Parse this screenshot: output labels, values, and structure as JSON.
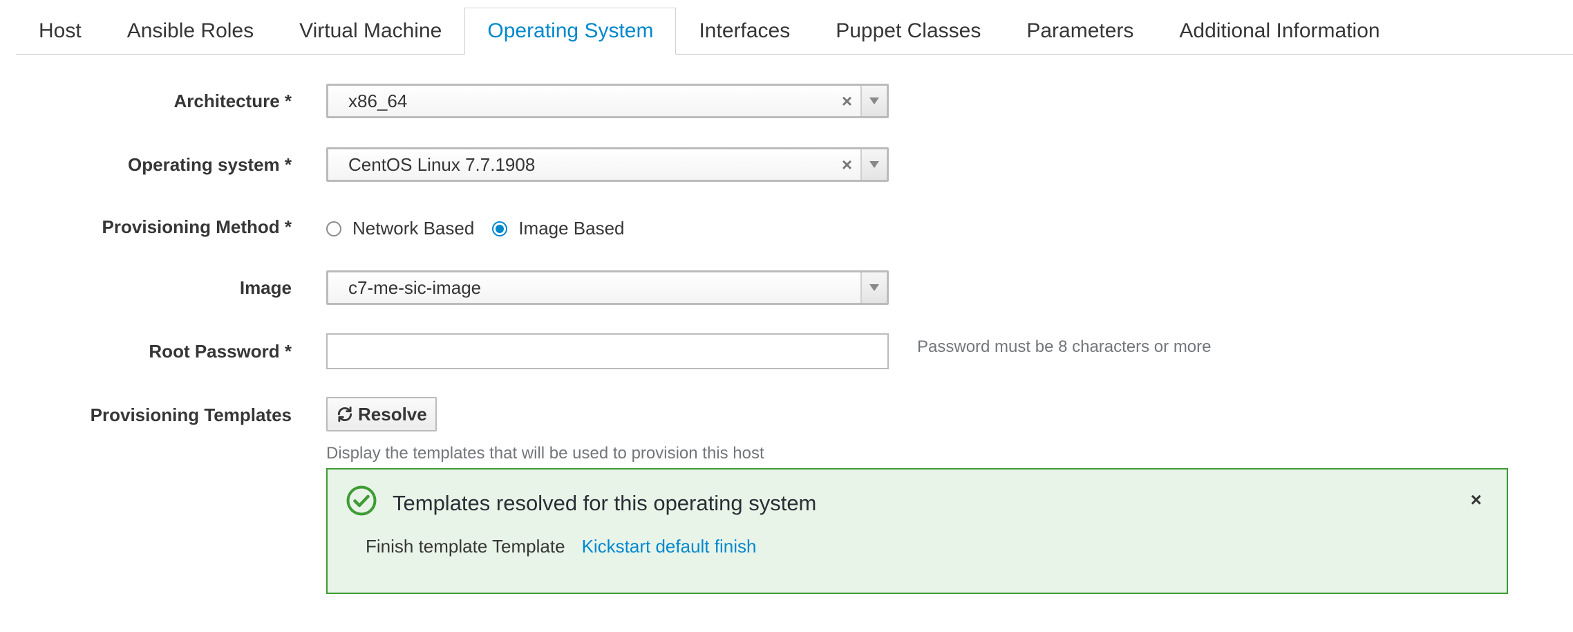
{
  "tabs": [
    {
      "label": "Host",
      "active": false
    },
    {
      "label": "Ansible Roles",
      "active": false
    },
    {
      "label": "Virtual Machine",
      "active": false
    },
    {
      "label": "Operating System",
      "active": true
    },
    {
      "label": "Interfaces",
      "active": false
    },
    {
      "label": "Puppet Classes",
      "active": false
    },
    {
      "label": "Parameters",
      "active": false
    },
    {
      "label": "Additional Information",
      "active": false
    }
  ],
  "form": {
    "architecture": {
      "label": "Architecture *",
      "value": "x86_64",
      "clear": "×"
    },
    "operating_system": {
      "label": "Operating system *",
      "value": "CentOS Linux 7.7.1908",
      "clear": "×"
    },
    "provisioning_method": {
      "label": "Provisioning Method *",
      "options": [
        {
          "label": "Network Based",
          "checked": false
        },
        {
          "label": "Image Based",
          "checked": true
        }
      ]
    },
    "image": {
      "label": "Image",
      "value": "c7-me-sic-image"
    },
    "root_password": {
      "label": "Root Password *",
      "value": "",
      "help": "Password must be 8 characters or more"
    },
    "provisioning_templates": {
      "label": "Provisioning Templates",
      "button_label": "Resolve",
      "help": "Display the templates that will be used to provision this host"
    }
  },
  "alert": {
    "title": "Templates resolved for this operating system",
    "close": "×",
    "detail_label": "Finish template Template",
    "detail_link": "Kickstart default finish"
  },
  "colors": {
    "accent": "#0088ce",
    "success_border": "#3f9c35",
    "success_bg": "#e9f4e9"
  }
}
